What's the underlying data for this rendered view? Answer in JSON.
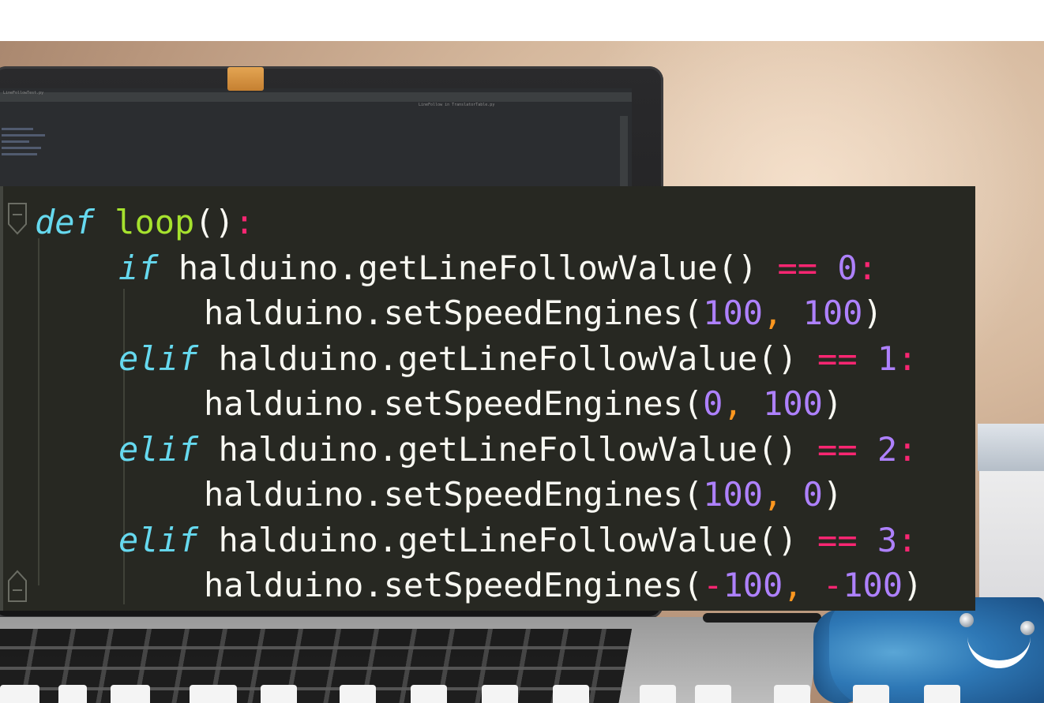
{
  "photo": {
    "ide_tab_title": "LineFollowTest.py",
    "ide_run_config": "LineFollow in TranslatorTable.py"
  },
  "code": {
    "lines": [
      {
        "indent": 0,
        "parts": [
          {
            "t": "def",
            "c": "kw"
          },
          {
            "t": " ",
            "c": "punct"
          },
          {
            "t": "loop",
            "c": "fn"
          },
          {
            "t": "()",
            "c": "punct"
          },
          {
            "t": ":",
            "c": "op"
          }
        ]
      },
      {
        "indent": 1,
        "parts": [
          {
            "t": "if",
            "c": "kw"
          },
          {
            "t": " halduino.getLineFollowValue() ",
            "c": "punct"
          },
          {
            "t": "==",
            "c": "op"
          },
          {
            "t": " ",
            "c": "punct"
          },
          {
            "t": "0",
            "c": "num"
          },
          {
            "t": ":",
            "c": "op"
          }
        ]
      },
      {
        "indent": 2,
        "parts": [
          {
            "t": "halduino.setSpeedEngines(",
            "c": "punct"
          },
          {
            "t": "100",
            "c": "num"
          },
          {
            "t": ",",
            "c": "comma"
          },
          {
            "t": " ",
            "c": "punct"
          },
          {
            "t": "100",
            "c": "num"
          },
          {
            "t": ")",
            "c": "punct"
          }
        ]
      },
      {
        "indent": 1,
        "parts": [
          {
            "t": "elif",
            "c": "kw"
          },
          {
            "t": " halduino.getLineFollowValue() ",
            "c": "punct"
          },
          {
            "t": "==",
            "c": "op"
          },
          {
            "t": " ",
            "c": "punct"
          },
          {
            "t": "1",
            "c": "num"
          },
          {
            "t": ":",
            "c": "op"
          }
        ]
      },
      {
        "indent": 2,
        "parts": [
          {
            "t": "halduino.setSpeedEngines(",
            "c": "punct"
          },
          {
            "t": "0",
            "c": "num"
          },
          {
            "t": ",",
            "c": "comma"
          },
          {
            "t": " ",
            "c": "punct"
          },
          {
            "t": "100",
            "c": "num"
          },
          {
            "t": ")",
            "c": "punct"
          }
        ]
      },
      {
        "indent": 1,
        "parts": [
          {
            "t": "elif",
            "c": "kw"
          },
          {
            "t": " halduino.getLineFollowValue() ",
            "c": "punct"
          },
          {
            "t": "==",
            "c": "op"
          },
          {
            "t": " ",
            "c": "punct"
          },
          {
            "t": "2",
            "c": "num"
          },
          {
            "t": ":",
            "c": "op"
          }
        ]
      },
      {
        "indent": 2,
        "parts": [
          {
            "t": "halduino.setSpeedEngines(",
            "c": "punct"
          },
          {
            "t": "100",
            "c": "num"
          },
          {
            "t": ",",
            "c": "comma"
          },
          {
            "t": " ",
            "c": "punct"
          },
          {
            "t": "0",
            "c": "num"
          },
          {
            "t": ")",
            "c": "punct"
          }
        ]
      },
      {
        "indent": 1,
        "parts": [
          {
            "t": "elif",
            "c": "kw"
          },
          {
            "t": " halduino.getLineFollowValue() ",
            "c": "punct"
          },
          {
            "t": "==",
            "c": "op"
          },
          {
            "t": " ",
            "c": "punct"
          },
          {
            "t": "3",
            "c": "num"
          },
          {
            "t": ":",
            "c": "op"
          }
        ]
      },
      {
        "indent": 2,
        "parts": [
          {
            "t": "halduino.setSpeedEngines(",
            "c": "punct"
          },
          {
            "t": "-",
            "c": "op"
          },
          {
            "t": "100",
            "c": "num"
          },
          {
            "t": ",",
            "c": "comma"
          },
          {
            "t": " ",
            "c": "punct"
          },
          {
            "t": "-",
            "c": "op"
          },
          {
            "t": "100",
            "c": "num"
          },
          {
            "t": ")",
            "c": "punct"
          }
        ]
      }
    ]
  },
  "colors": {
    "code_background": "#272822",
    "keyword": "#66d9ef",
    "function_name": "#a6e22e",
    "number": "#ae81ff",
    "operator": "#f92672",
    "comma": "#fd971f",
    "default_text": "#f8f8f2",
    "robot_blue": "#2e78b6",
    "camera_sticker": "#e4a553"
  }
}
